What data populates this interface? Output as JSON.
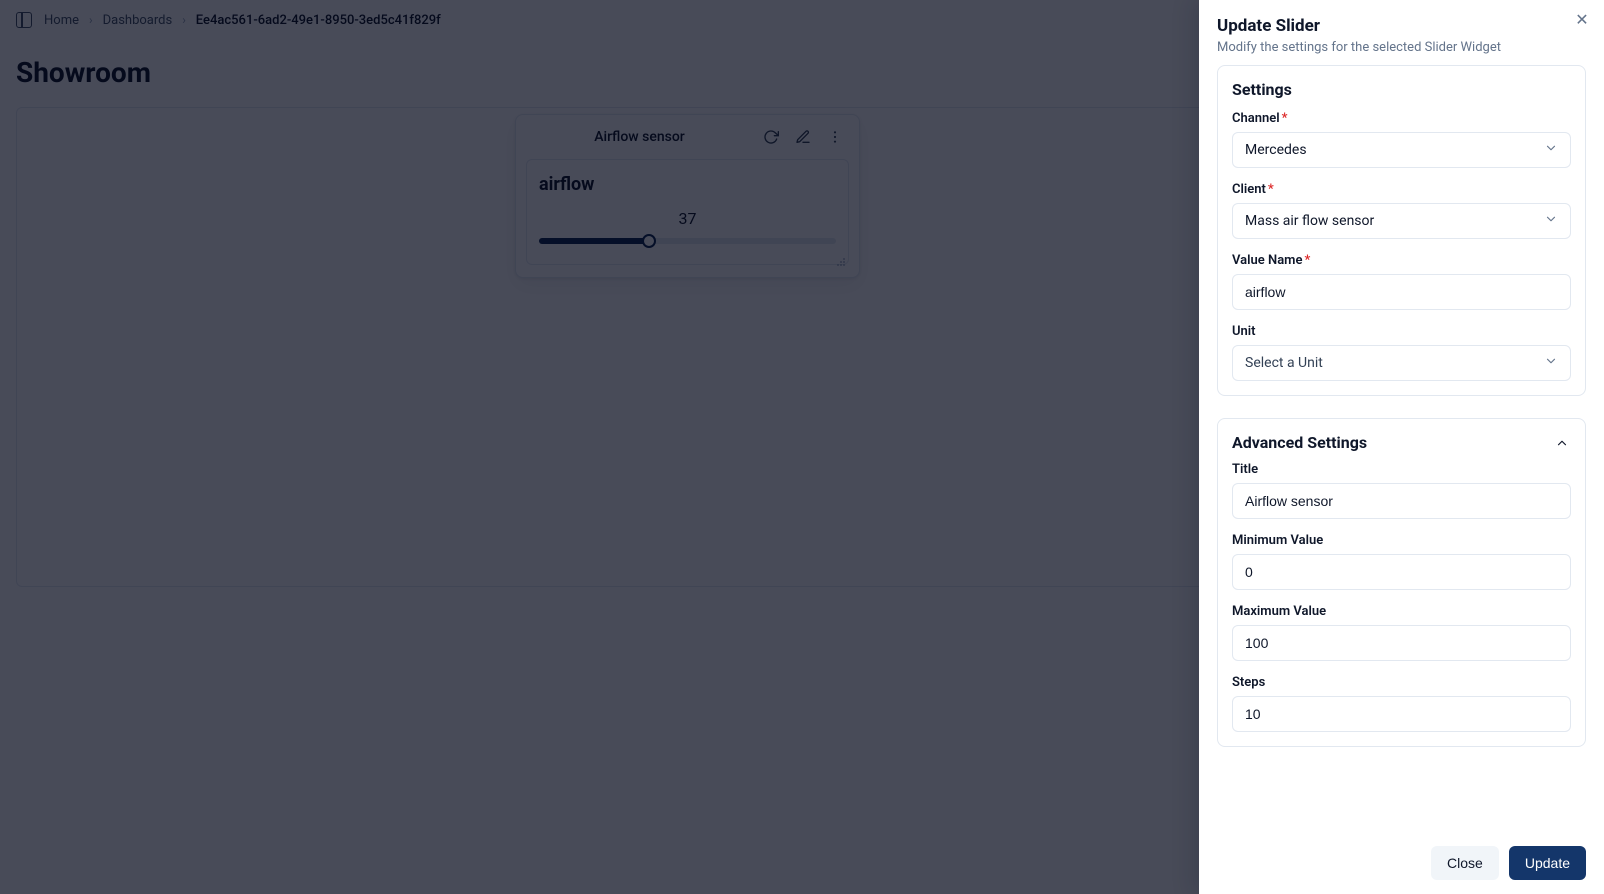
{
  "breadcrumb": {
    "home": "Home",
    "dashboards": "Dashboards",
    "current": "Ee4ac561-6ad2-49e1-8950-3ed5c41f829f"
  },
  "page": {
    "title": "Showroom"
  },
  "widget": {
    "header_title": "Airflow sensor",
    "slider_name": "airflow",
    "value": "37",
    "percent": 37
  },
  "panel": {
    "title": "Update Slider",
    "subtitle": "Modify the settings for the selected Slider Widget",
    "settings_heading": "Settings",
    "channel_label": "Channel",
    "channel_value": "Mercedes",
    "client_label": "Client",
    "client_value": "Mass air flow sensor",
    "value_name_label": "Value Name",
    "value_name_value": "airflow",
    "unit_label": "Unit",
    "unit_placeholder": "Select a Unit",
    "advanced_heading": "Advanced Settings",
    "adv_title_label": "Title",
    "adv_title_value": "Airflow sensor",
    "min_label": "Minimum Value",
    "min_value": "0",
    "max_label": "Maximum Value",
    "max_value": "100",
    "steps_label": "Steps",
    "steps_value": "10",
    "close_label": "Close",
    "update_label": "Update"
  }
}
